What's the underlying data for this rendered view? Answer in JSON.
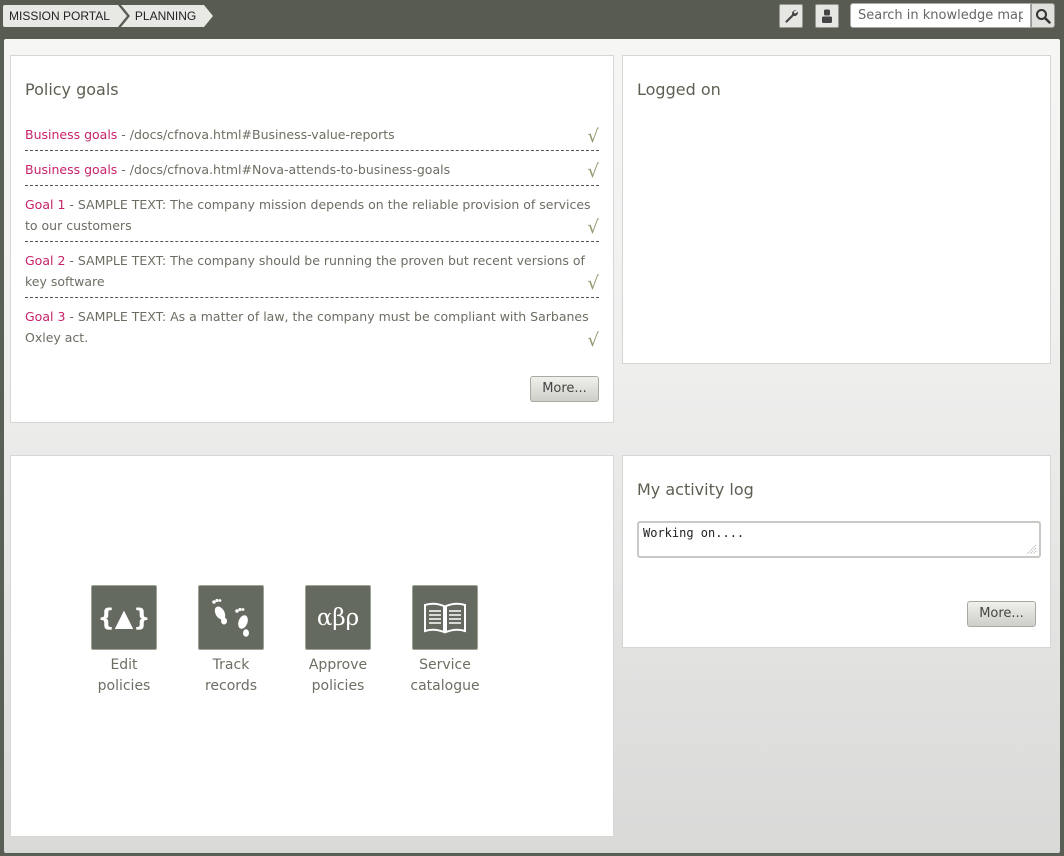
{
  "breadcrumb": [
    "MISSION PORTAL",
    "PLANNING"
  ],
  "search": {
    "placeholder": "Search in knowledge map"
  },
  "policy_goals": {
    "title": "Policy goals",
    "items": [
      {
        "link": "Business goals",
        "text": " - /docs/cfnova.html#Business-value-reports",
        "status": "√"
      },
      {
        "link": "Business goals",
        "text": " - /docs/cfnova.html#Nova-attends-to-business-goals",
        "status": "√"
      },
      {
        "link": "Goal 1",
        "text": " - SAMPLE TEXT: The company mission depends on the reliable provision of services to our customers",
        "status": "√"
      },
      {
        "link": "Goal 2",
        "text": " - SAMPLE TEXT: The company should be running the proven but recent versions of key software",
        "status": "√"
      },
      {
        "link": "Goal 3",
        "text": " - SAMPLE TEXT: As a matter of law, the company must be compliant with Sarbanes Oxley act.",
        "status": "√"
      }
    ],
    "more_label": "More..."
  },
  "logged_on": {
    "title": "Logged on"
  },
  "apps": [
    {
      "icon": "edit-policies-icon",
      "glyph": "{▲}",
      "label_line1": "Edit",
      "label_line2": "policies"
    },
    {
      "icon": "footprints-icon",
      "glyph": "",
      "label_line1": "Track",
      "label_line2": "records"
    },
    {
      "icon": "greek-letters-icon",
      "glyph": "αβρ",
      "label_line1": "Approve",
      "label_line2": "policies"
    },
    {
      "icon": "open-book-icon",
      "glyph": "",
      "label_line1": "Service",
      "label_line2": "catalogue"
    }
  ],
  "activity_log": {
    "title": "My activity log",
    "value": "Working on....",
    "more_label": "More..."
  }
}
